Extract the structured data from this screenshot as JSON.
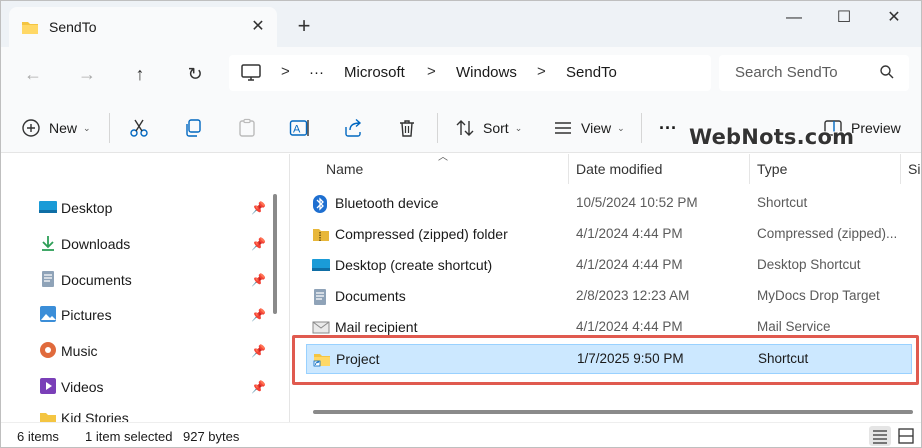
{
  "tab": {
    "title": "SendTo",
    "close_symbol": "✕",
    "new_tab_symbol": "+"
  },
  "window_controls": {
    "minimize": "—",
    "maximize": "☐",
    "close": "✕"
  },
  "nav": {
    "back": "←",
    "forward": "→",
    "up": "↑",
    "refresh": "↻"
  },
  "address": {
    "more": "···",
    "crumbs": [
      "Microsoft",
      "Windows",
      "SendTo"
    ],
    "sep": ">"
  },
  "search": {
    "placeholder": "Search SendTo"
  },
  "toolbar": {
    "new_label": "New",
    "sort_label": "Sort",
    "view_label": "View",
    "more_label": "···",
    "preview_label": "Preview",
    "chevron": "⌄"
  },
  "watermark": "WebNots.com",
  "sidebar": {
    "items": [
      {
        "label": "Desktop",
        "icon": "desktop-icon",
        "pinned": true
      },
      {
        "label": "Downloads",
        "icon": "downloads-icon",
        "pinned": true
      },
      {
        "label": "Documents",
        "icon": "documents-icon",
        "pinned": true
      },
      {
        "label": "Pictures",
        "icon": "pictures-icon",
        "pinned": true
      },
      {
        "label": "Music",
        "icon": "music-icon",
        "pinned": true
      },
      {
        "label": "Videos",
        "icon": "videos-icon",
        "pinned": true
      },
      {
        "label": "Kid Stories",
        "icon": "folder-icon",
        "pinned": false
      }
    ],
    "pin_symbol": "📌"
  },
  "columns": {
    "name": "Name",
    "date": "Date modified",
    "type": "Type",
    "size": "Size"
  },
  "files": [
    {
      "name": "Bluetooth device",
      "date": "10/5/2024 10:52 PM",
      "type": "Shortcut",
      "icon": "bluetooth-icon"
    },
    {
      "name": "Compressed (zipped) folder",
      "date": "4/1/2024 4:44 PM",
      "type": "Compressed (zipped)...",
      "icon": "zip-folder-icon"
    },
    {
      "name": "Desktop (create shortcut)",
      "date": "4/1/2024 4:44 PM",
      "type": "Desktop Shortcut",
      "icon": "desktop-icon"
    },
    {
      "name": "Documents",
      "date": "2/8/2023 12:23 AM",
      "type": "MyDocs Drop Target",
      "icon": "documents-icon"
    },
    {
      "name": "Mail recipient",
      "date": "4/1/2024 4:44 PM",
      "type": "Mail Service",
      "icon": "mail-icon"
    },
    {
      "name": "Project",
      "date": "1/7/2025 9:50 PM",
      "type": "Shortcut",
      "icon": "folder-shortcut-icon",
      "selected": true
    }
  ],
  "status": {
    "items": "6 items",
    "selected": "1 item selected",
    "size": "927 bytes"
  },
  "colors": {
    "accent": "#0067c0",
    "selection": "#cce8ff",
    "highlight_box": "#e05a4f",
    "folder": "#f4c542"
  }
}
